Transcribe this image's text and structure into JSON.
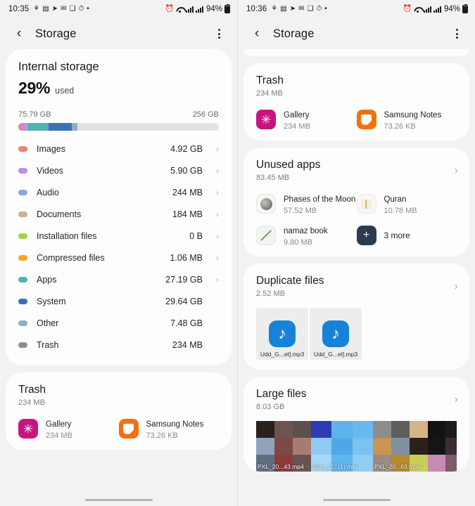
{
  "left": {
    "status": {
      "time": "10:35",
      "battery_percent": "94%",
      "icons": [
        "shamrock-icon",
        "app-icon",
        "telegram-icon",
        "gmail-icon",
        "facebook-icon",
        "clock-icon",
        "dot-icon"
      ],
      "right_icons": [
        "alarm-icon",
        "wifi-icon",
        "signal-icon",
        "signal2-icon",
        "battery-icon"
      ]
    },
    "appbar": {
      "title": "Storage",
      "back": "‹",
      "menu": "more-options"
    },
    "internal_storage": {
      "title": "Internal storage",
      "percent": "29%",
      "used_label": "used",
      "used_capacity": "75.79 GB",
      "total_capacity": "256 GB"
    },
    "bar_segments": [
      {
        "name": "Images",
        "color": "#ef8279",
        "width_pct": 1.9
      },
      {
        "name": "Videos",
        "color": "#c08de8",
        "width_pct": 2.3
      },
      {
        "name": "Audio",
        "color": "#8aa8e8",
        "width_pct": 0.1
      },
      {
        "name": "Documents",
        "color": "#cbb38c",
        "width_pct": 0.1
      },
      {
        "name": "Apps",
        "color": "#4fb3ae",
        "width_pct": 10.6
      },
      {
        "name": "System",
        "color": "#3a72b5",
        "width_pct": 11.6
      },
      {
        "name": "Other",
        "color": "#8fb0c4",
        "width_pct": 2.9
      }
    ],
    "categories": [
      {
        "label": "Images",
        "size": "4.92 GB",
        "color": "#ef8279",
        "chevron": "›"
      },
      {
        "label": "Videos",
        "size": "5.90 GB",
        "color": "#c08de8",
        "chevron": "›"
      },
      {
        "label": "Audio",
        "size": "244 MB",
        "color": "#8aa8e8",
        "chevron": "›"
      },
      {
        "label": "Documents",
        "size": "184 MB",
        "color": "#cbb38c",
        "chevron": "›"
      },
      {
        "label": "Installation files",
        "size": "0 B",
        "color": "#a8d04f",
        "chevron": "›"
      },
      {
        "label": "Compressed files",
        "size": "1.06 MB",
        "color": "#f5a623",
        "chevron": "›"
      },
      {
        "label": "Apps",
        "size": "27.19 GB",
        "color": "#4fb3ae",
        "chevron": "›"
      },
      {
        "label": "System",
        "size": "29.64 GB",
        "color": "#3a72b5",
        "chevron": ""
      },
      {
        "label": "Other",
        "size": "7.48 GB",
        "color": "#8fb0c4",
        "chevron": ""
      },
      {
        "label": "Trash",
        "size": "234 MB",
        "color": "#8a8f99",
        "chevron": ""
      }
    ],
    "trash": {
      "title": "Trash",
      "subtitle": "234 MB",
      "apps": [
        {
          "name": "Gallery",
          "size": "234 MB",
          "icon": "gallery-icon"
        },
        {
          "name": "Samsung Notes",
          "size": "73.26 KB",
          "icon": "samsung-notes-icon"
        }
      ]
    }
  },
  "right": {
    "status": {
      "time": "10:36",
      "battery_percent": "94%"
    },
    "appbar": {
      "title": "Storage",
      "back": "‹",
      "menu": "more-options"
    },
    "trash": {
      "title": "Trash",
      "subtitle": "234 MB",
      "apps": [
        {
          "name": "Gallery",
          "size": "234 MB",
          "icon": "gallery-icon"
        },
        {
          "name": "Samsung Notes",
          "size": "73.26 KB",
          "icon": "samsung-notes-icon"
        }
      ]
    },
    "unused_apps": {
      "title": "Unused apps",
      "subtitle": "83.45 MB",
      "chevron": "›",
      "apps": [
        {
          "name": "Phases of the Moon",
          "size": "57.52 MB",
          "icon": "moon-app-icon"
        },
        {
          "name": "Quran",
          "size": "10.78 MB",
          "icon": "quran-app-icon"
        },
        {
          "name": "namaz book",
          "size": "9.80 MB",
          "icon": "namaz-app-icon"
        },
        {
          "name": "3 more",
          "size": "",
          "icon": "more-apps-icon"
        }
      ]
    },
    "duplicate_files": {
      "title": "Duplicate files",
      "subtitle": "2.52 MB",
      "chevron": "›",
      "files": [
        {
          "name": "Udd_G...et].mp3",
          "icon": "music-file-icon"
        },
        {
          "name": "Udd_G...et].mp3",
          "icon": "music-file-icon"
        }
      ]
    },
    "large_files": {
      "title": "Large files",
      "subtitle": "8.03 GB",
      "chevron": "›",
      "files": [
        {
          "name": "PXL_20...43.mp4"
        },
        {
          "name": "Soul_(2...(1).mkv"
        },
        {
          "name": "PXL_20...63.mp4"
        },
        {
          "name": ""
        }
      ]
    }
  }
}
